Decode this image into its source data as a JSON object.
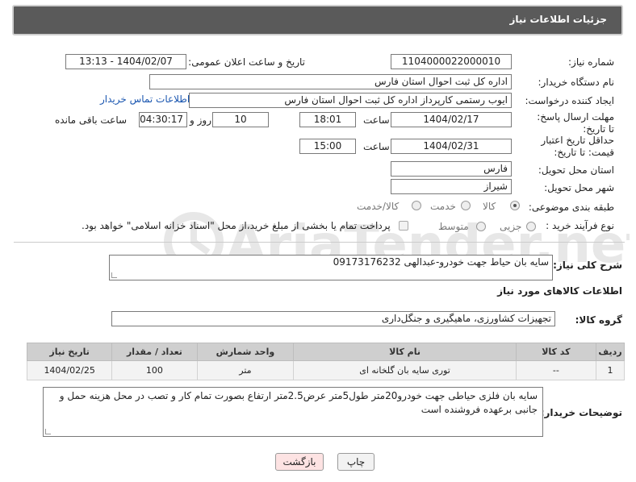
{
  "header": {
    "title": "جزئیات اطلاعات نیاز"
  },
  "labels": {
    "need_number": "شماره نیاز:",
    "announce_datetime": "تاریخ و ساعت اعلان عمومی:",
    "buyer_org": "نام دستگاه خریدار:",
    "requester": "ایجاد کننده درخواست:",
    "reply_deadline": "مهلت ارسال پاسخ: تا تاریخ:",
    "time": "ساعت",
    "days_and": "روز و",
    "time_remaining": "ساعت باقی مانده",
    "price_validity": "حداقل تاریخ اعتبار قیمت: تا تاریخ:",
    "time2": "ساعت",
    "delivery_province": "استان محل تحویل:",
    "delivery_city": "شهر محل تحویل:",
    "category": "طبقه بندی موضوعی:",
    "purchase_type": "نوع فرآیند خرید :",
    "general_desc": "شرح کلی نیاز:",
    "goods_info": "اطلاعات کالاهای مورد نیاز",
    "goods_group": "گروه کالا:",
    "buyer_notes": "توضیحات خریدار:"
  },
  "values": {
    "need_number": "1104000022000010",
    "announce_datetime": "1404/02/07 - 13:13",
    "buyer_org": "اداره کل ثبت احوال استان فارس",
    "requester": "ایوب رستمی کارپرداز اداره کل ثبت احوال استان فارس",
    "buyer_contact_link": "اطلاعات تماس خریدار",
    "reply_date": "1404/02/17",
    "reply_time": "18:01",
    "reply_days": "10",
    "remaining_time": "04:30:17",
    "price_date": "1404/02/31",
    "price_time": "15:00",
    "province": "فارس",
    "city": "شیراز",
    "general_desc": "سایه بان حیاط جهت خودرو-عبدالهی 09173176232",
    "goods_group": "تجهیزات کشاورزی، ماهیگیری و جنگل‌داری",
    "buyer_notes": "سایه بان فلزی حیاطی جهت خودرو20متر طول5متر عرض2.5متر ارتفاع بصورت تمام کار و تصب در محل هزینه حمل و جانبی برعهده فروشنده است"
  },
  "category_options": [
    {
      "label": "کالا",
      "selected": true
    },
    {
      "label": "خدمت",
      "selected": false
    },
    {
      "label": "کالا/خدمت",
      "selected": false
    }
  ],
  "purchase_options": [
    {
      "label": "جزیی",
      "selected": false
    },
    {
      "label": "متوسط",
      "selected": false
    }
  ],
  "payment_note": "پرداخت تمام یا بخشی از مبلغ خرید،از محل \"اسناد خزانه اسلامی\" خواهد بود.",
  "table": {
    "headers": [
      "ردیف",
      "کد کالا",
      "نام کالا",
      "واحد شمارش",
      "تعداد / مقدار",
      "تاریخ نیاز"
    ],
    "rows": [
      [
        "1",
        "--",
        "توری سایه بان گلخانه ای",
        "متر",
        "100",
        "1404/02/25"
      ]
    ]
  },
  "buttons": {
    "print": "چاپ",
    "back": "بازگشت"
  },
  "watermark": {
    "text": "AriaTender.net"
  },
  "colors": {
    "header_bg": "#5a5a5a",
    "link": "#1a56b0",
    "back_button_bg": "#fde3e3"
  }
}
